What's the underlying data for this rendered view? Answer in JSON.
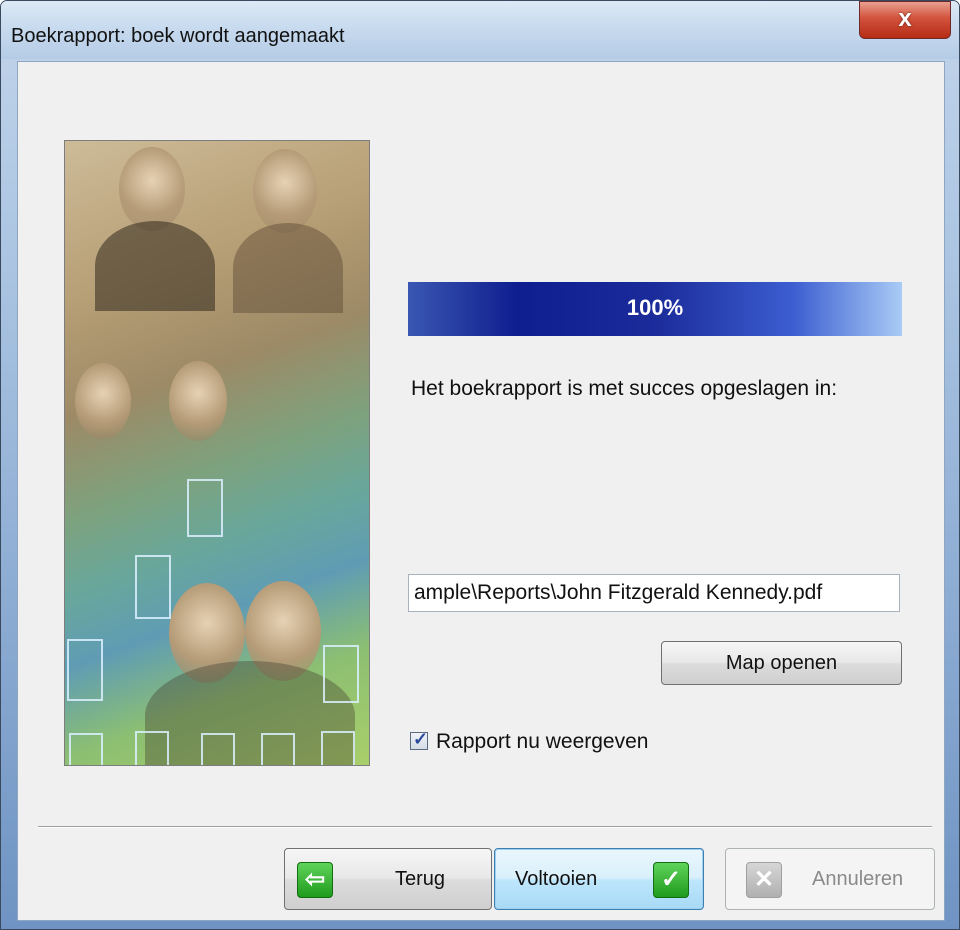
{
  "window": {
    "title": "Boekrapport: boek wordt aangemaakt",
    "close_glyph": "x"
  },
  "progress": {
    "value": 1.0,
    "label": "100%"
  },
  "message": "Het boekrapport is met succes opgeslagen in:",
  "path_field": {
    "value": "ample\\Reports\\John Fitzgerald Kennedy.pdf"
  },
  "open_folder_button": {
    "label": "Map openen"
  },
  "show_report_checkbox": {
    "label": "Rapport nu weergeven",
    "checked": true
  },
  "footer": {
    "back_button": {
      "label": "Terug",
      "icon": "arrow-left-icon"
    },
    "finish_button": {
      "label": "Voltooien",
      "icon": "checkmark-icon"
    },
    "cancel_button": {
      "label": "Annuleren",
      "icon": "x-icon",
      "disabled": true
    }
  },
  "colors": {
    "progress_dark": "#0f1e8f",
    "accent_green": "#1f9b1c",
    "close_red": "#c6301a"
  }
}
